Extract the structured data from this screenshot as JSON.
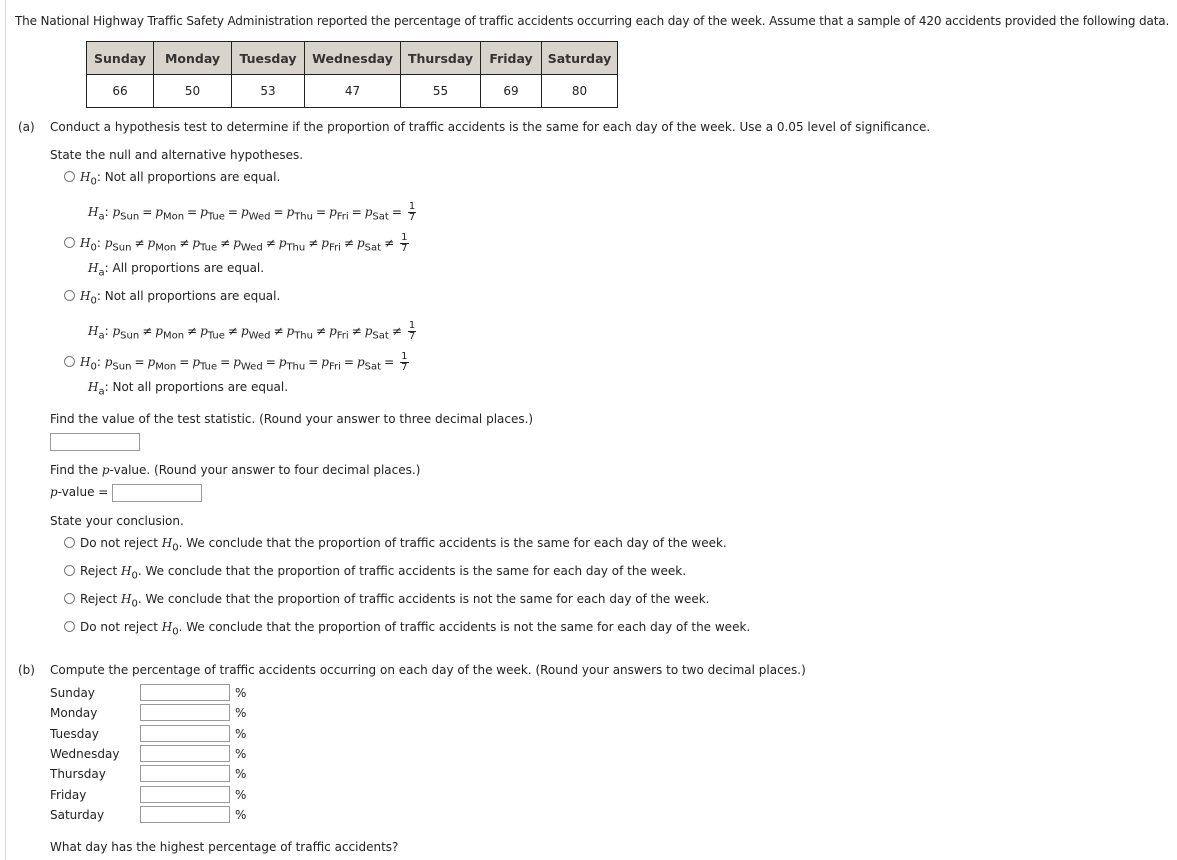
{
  "intro_text": "The National Highway Traffic Safety Administration reported the percentage of traffic accidents occurring each day of the week. Assume that a sample of 420 accidents provided the following data.",
  "table": {
    "headers": [
      "Sunday",
      "Monday",
      "Tuesday",
      "Wednesday",
      "Thursday",
      "Friday",
      "Saturday"
    ],
    "values": [
      "66",
      "50",
      "53",
      "47",
      "55",
      "69",
      "80"
    ]
  },
  "part_a": {
    "label": "(a)",
    "prompt": "Conduct a hypothesis test to determine if the proportion of traffic accidents is the same for each day of the week. Use a 0.05 level of significance.",
    "hypotheses_prompt": "State the null and alternative hypotheses.",
    "symbols": {
      "H": "H",
      "null_sub": "0",
      "alt_sub": "a",
      "p": "p",
      "colon": ":",
      "frac_num": "1",
      "frac_den": "7"
    },
    "day_subs": [
      "Sun",
      "Mon",
      "Tue",
      "Wed",
      "Thu",
      "Fri",
      "Sat"
    ],
    "options": [
      {
        "h0_text": "Not all proportions are equal.",
        "ha_operator": "="
      },
      {
        "h0_operator": "≠",
        "ha_text": "All proportions are equal."
      },
      {
        "h0_text": "Not all proportions are equal.",
        "ha_operator": "≠"
      },
      {
        "h0_operator": "=",
        "ha_text": "Not all proportions are equal."
      }
    ],
    "test_stat_prompt": "Find the value of the test statistic. (Round your answer to three decimal places.)",
    "test_stat_value": "",
    "pvalue_prompt_pre": "Find the ",
    "pvalue_prompt_p": "p",
    "pvalue_prompt_post": "-value. (Round your answer to four decimal places.)",
    "pvalue_label_p": "p",
    "pvalue_label_post": "-value =",
    "pvalue_value": "",
    "conclusion_prompt": "State your conclusion.",
    "conclusions": [
      {
        "action": "Do not reject",
        "text": ". We conclude that the proportion of traffic accidents is the same for each day of the week."
      },
      {
        "action": "Reject",
        "text": ". We conclude that the proportion of traffic accidents is the same for each day of the week."
      },
      {
        "action": "Reject",
        "text": ". We conclude that the proportion of traffic accidents is not the same for each day of the week."
      },
      {
        "action": "Do not reject",
        "text": ". We conclude that the proportion of traffic accidents is not the same for each day of the week."
      }
    ]
  },
  "part_b": {
    "label": "(b)",
    "prompt": "Compute the percentage of traffic accidents occurring on each day of the week. (Round your answers to two decimal places.)",
    "rows": [
      {
        "day": "Sunday",
        "value": "",
        "unit": "%"
      },
      {
        "day": "Monday",
        "value": "",
        "unit": "%"
      },
      {
        "day": "Tuesday",
        "value": "",
        "unit": "%"
      },
      {
        "day": "Wednesday",
        "value": "",
        "unit": "%"
      },
      {
        "day": "Thursday",
        "value": "",
        "unit": "%"
      },
      {
        "day": "Friday",
        "value": "",
        "unit": "%"
      },
      {
        "day": "Saturday",
        "value": "",
        "unit": "%"
      }
    ],
    "highest_prompt": "What day has the highest percentage of traffic accidents?"
  }
}
